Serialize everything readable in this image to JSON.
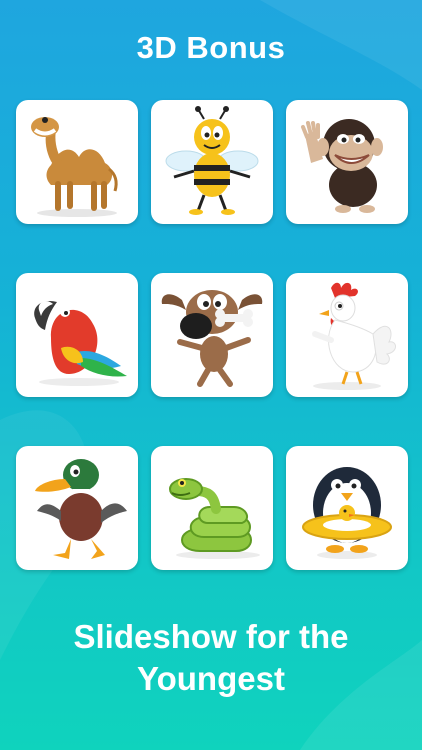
{
  "header": {
    "title": "3D Bonus"
  },
  "tiles": [
    {
      "animal": "camel",
      "icon": "camel-icon"
    },
    {
      "animal": "bee",
      "icon": "bee-icon"
    },
    {
      "animal": "monkey",
      "icon": "monkey-icon"
    },
    {
      "animal": "parrot",
      "icon": "parrot-icon"
    },
    {
      "animal": "dog",
      "icon": "dog-icon"
    },
    {
      "animal": "rooster",
      "icon": "rooster-icon"
    },
    {
      "animal": "duck",
      "icon": "duck-icon"
    },
    {
      "animal": "snake",
      "icon": "snake-icon"
    },
    {
      "animal": "penguin",
      "icon": "penguin-icon"
    }
  ],
  "footer": {
    "line1": "Slideshow for the",
    "line2": "Youngest"
  },
  "colors": {
    "background_top": "#1fa6df",
    "background_bottom": "#0fd3bd",
    "text": "#ffffff",
    "tile": "#ffffff"
  }
}
